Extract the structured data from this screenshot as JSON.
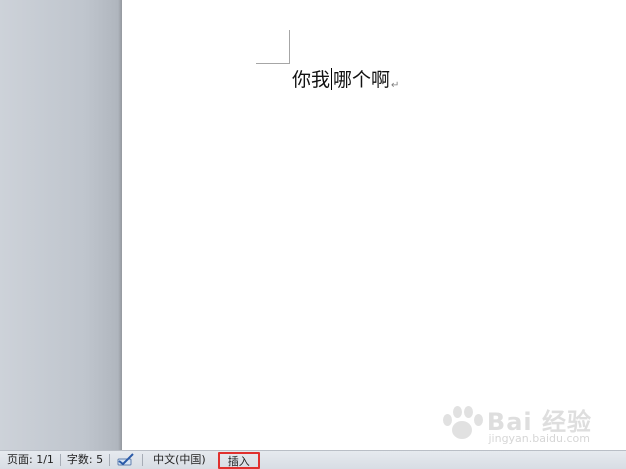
{
  "document": {
    "text_before_caret": "你我",
    "text_after_caret": "哪个啊",
    "paragraph_mark": "↵"
  },
  "statusbar": {
    "page_label": "页面: 1/1",
    "word_count_label": "字数: 5",
    "proofing_icon": "proofing-check-icon",
    "language_label": "中文(中国)",
    "insert_mode_label": "插入",
    "highlight_color": "#e0302e"
  },
  "watermark": {
    "text": "Bai 经验",
    "subtext": "jingyan.baidu.com"
  }
}
